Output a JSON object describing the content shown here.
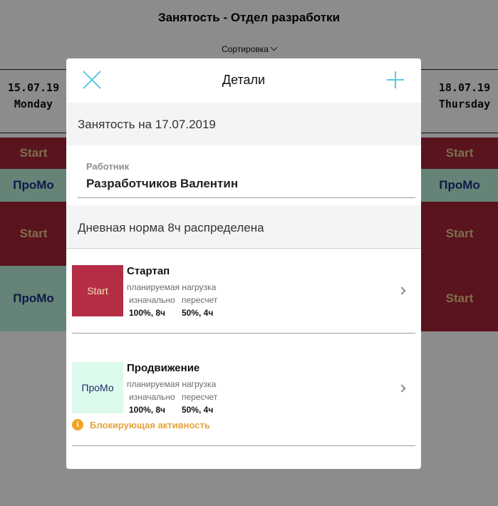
{
  "background": {
    "title": "Занятость - Отдел разработки",
    "sort_label": "Сортировка",
    "left_date": {
      "date": "15.07.19",
      "day": "Monday"
    },
    "right_date": {
      "date": "18.07.19",
      "day": "Thursday"
    },
    "left_cells": [
      "Start",
      "ПроМо",
      "Start",
      "ПроМо"
    ],
    "right_cells": [
      "Start",
      "ПроМо",
      "Start",
      "Start"
    ]
  },
  "modal": {
    "title": "Детали",
    "occupancy_label": "Занятость на 17.07.2019",
    "worker_label": "Работник",
    "worker_name": "Разработчиков Валентин",
    "norm_label": "Дневная норма 8ч распределена",
    "projects": [
      {
        "thumb": "Start",
        "name": "Стартап",
        "load_label": "планируемая нагрузка",
        "col_initial": "изначально",
        "col_recalc": "пересчет",
        "val_initial": "100%, 8ч",
        "val_recalc": "50%, 4ч"
      },
      {
        "thumb": "ПроМо",
        "name": "Продвижение",
        "load_label": "планируемая нагрузка",
        "col_initial": "изначально",
        "col_recalc": "пересчет",
        "val_initial": "100%, 8ч",
        "val_recalc": "50%, 4ч",
        "warning": "Блокирующая активность"
      }
    ]
  },
  "colors": {
    "accent": "#5ac8e0",
    "start_bg": "#b52d45",
    "promo_bg": "#dcfbec",
    "warning": "#e6a23c"
  },
  "icons": {
    "close": "close-icon",
    "add": "plus-icon",
    "chevron": "chevron-right-icon",
    "warning": "info-warning-icon"
  }
}
